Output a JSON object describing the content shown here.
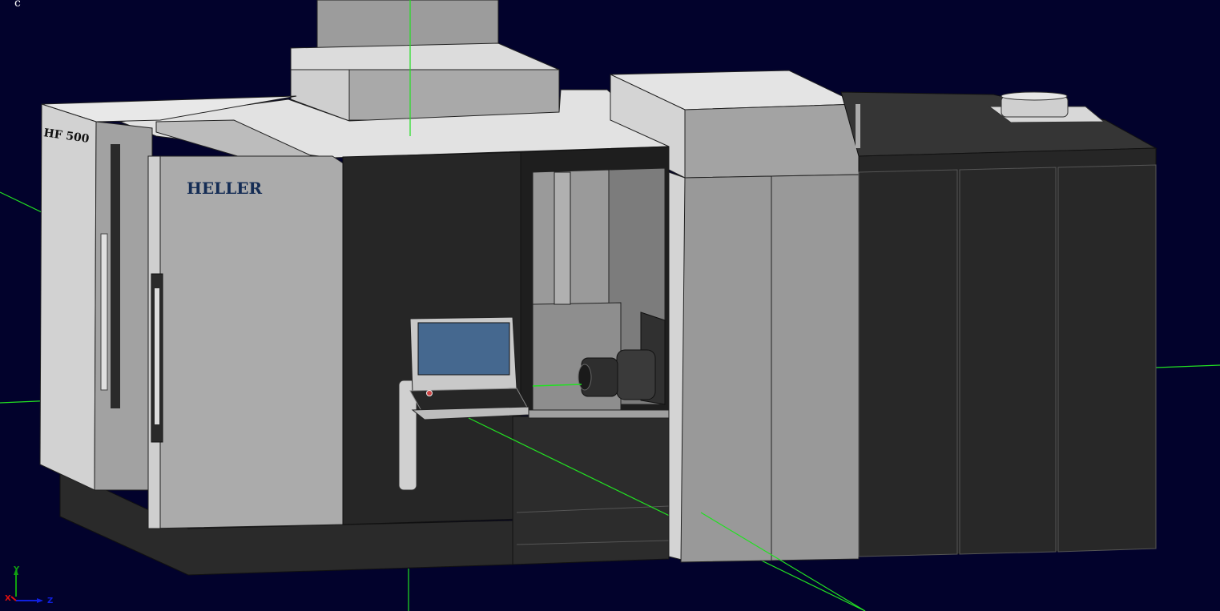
{
  "viewer": {
    "corner_label": "c",
    "background_color": "#02022c",
    "axis_line_color": "#22e022"
  },
  "model": {
    "brand_label": "HELLER",
    "model_badge": "HF 500",
    "screen_color": "#45688f"
  },
  "triad": {
    "x_label": "X",
    "y_label": "Y",
    "z_label": "Z",
    "x_color": "#e01010",
    "y_color": "#10a010",
    "z_color": "#1020e0"
  }
}
